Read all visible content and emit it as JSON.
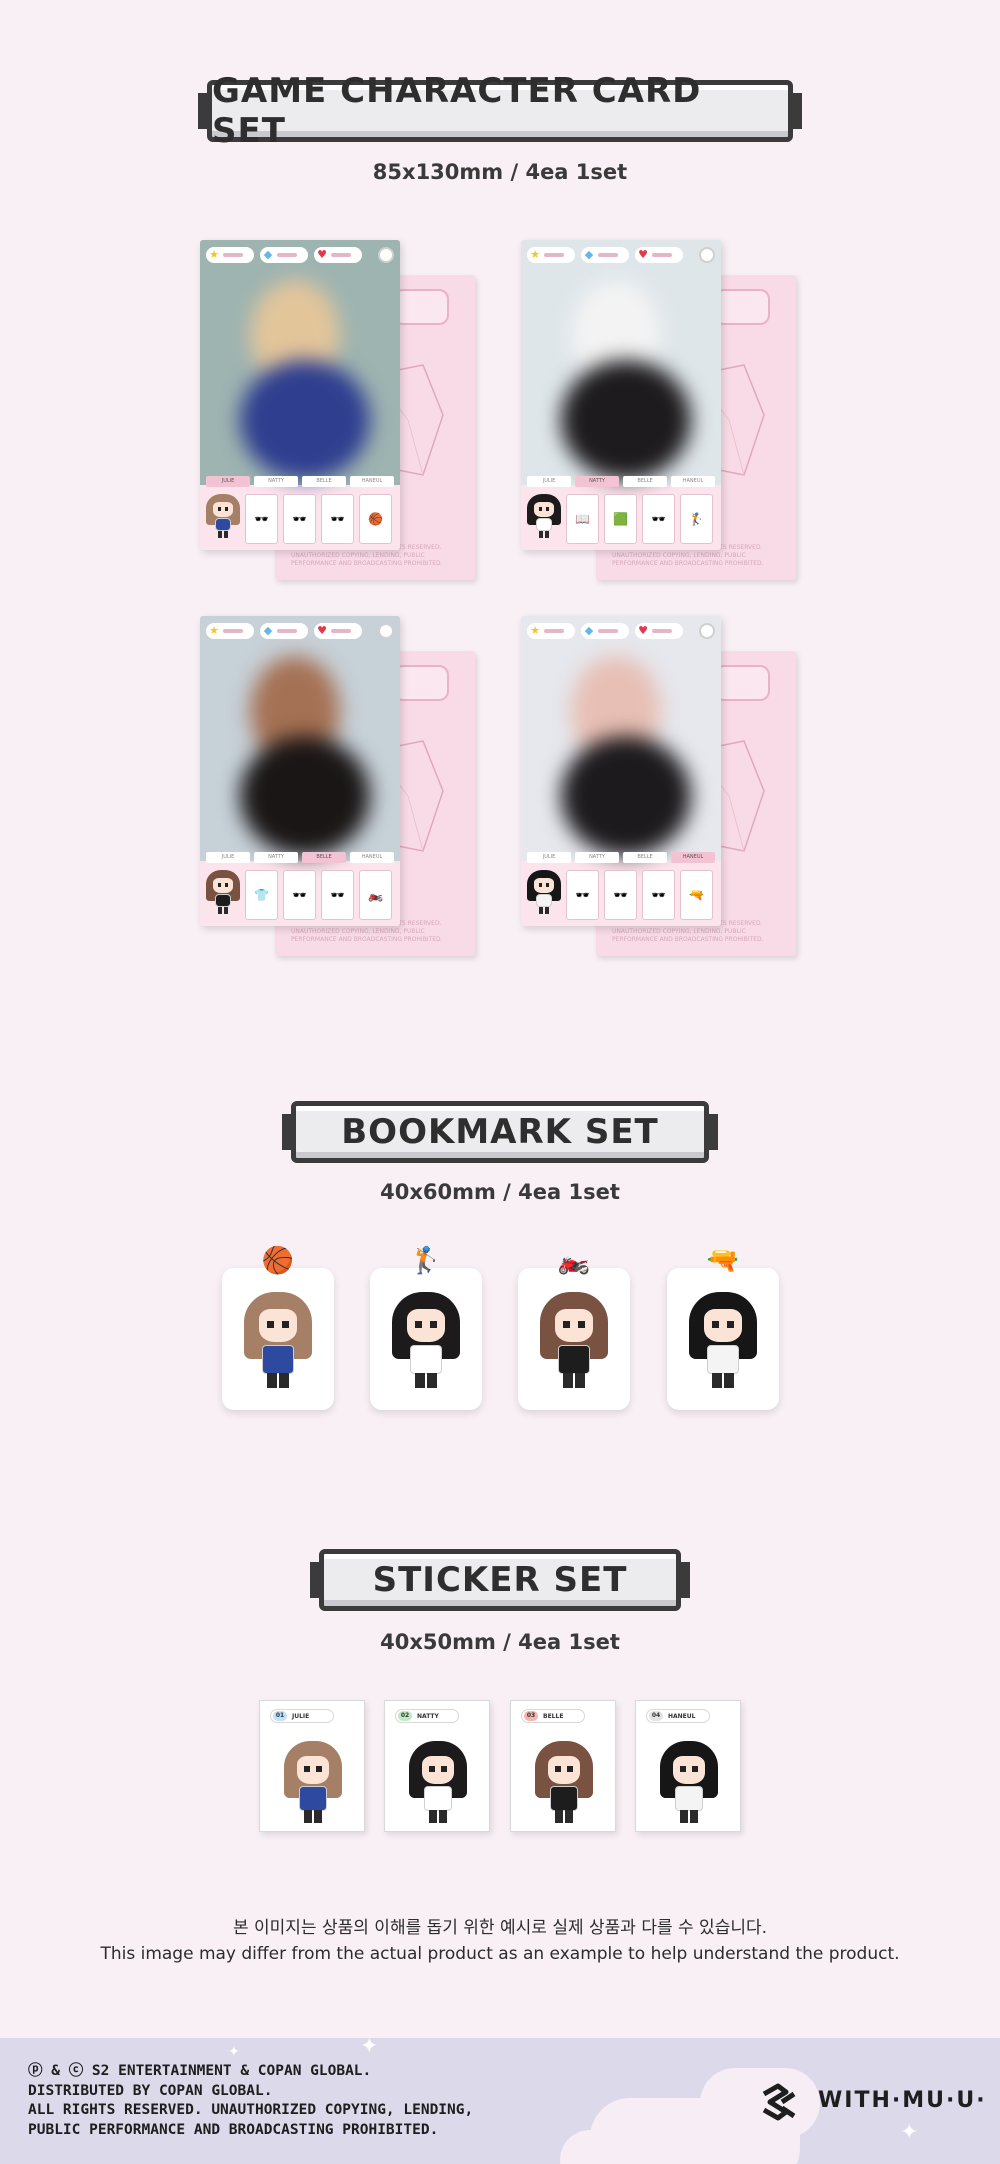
{
  "sections": {
    "cards": {
      "title": "GAME CHARACTER CARD SET",
      "spec": "85x130mm  /  4ea 1set"
    },
    "bookmarks": {
      "title": "BOOKMARK SET",
      "spec": "40x60mm  /  4ea 1set"
    },
    "stickers": {
      "title": "STICKER SET",
      "spec": "40x50mm  /  4ea 1set"
    }
  },
  "cards": [
    {
      "member": "JULIE",
      "active_tab": 0,
      "item_icons": [
        "🕶️",
        "🕶️",
        "🕶️",
        "🏀"
      ],
      "photo_colors": [
        "#9eb4b1",
        "#2f3e8f",
        "#e3c59a"
      ]
    },
    {
      "member": "NATTY",
      "active_tab": 1,
      "item_icons": [
        "📖",
        "🟩",
        "🕶️",
        "🏌️"
      ],
      "photo_colors": [
        "#dfe6ea",
        "#1d1b1e",
        "#f3f3f3"
      ]
    },
    {
      "member": "BELLE",
      "active_tab": 2,
      "item_icons": [
        "👕",
        "🕶️",
        "🕶️",
        "🏍️"
      ],
      "photo_colors": [
        "#c7d1d8",
        "#1a1616",
        "#a57154"
      ]
    },
    {
      "member": "HANEUL",
      "active_tab": 3,
      "item_icons": [
        "🕶️",
        "🕶️",
        "🕶️",
        "🔫"
      ],
      "photo_colors": [
        "#e6e8ee",
        "#1c1a1d",
        "#e7bfb4"
      ]
    }
  ],
  "card_tabs": [
    "JULIE",
    "NATTY",
    "BELLE",
    "HANEUL"
  ],
  "hud_icons": {
    "star": "★",
    "gem": "◆",
    "heart": "♥"
  },
  "card_fine_print": "ⓟ&ⓒS2 ENTERTAINMENT. ALL RIGHTS RESERVED. UNAUTHORIZED COPYING, LENDING, PUBLIC PERFORMANCE AND BROADCASTING PROHIBITED.",
  "bookmarks": [
    {
      "member": "JULIE",
      "item": "🏀",
      "hair": "#a57f66",
      "outfit": "#2e4aa0"
    },
    {
      "member": "NATTY",
      "item": "🏌️",
      "hair": "#1c1a1a",
      "outfit": "#ffffff"
    },
    {
      "member": "BELLE",
      "item": "🏍️",
      "hair": "#7a5241",
      "outfit": "#1d1d1d"
    },
    {
      "member": "HANEUL",
      "item": "🔫",
      "hair": "#161616",
      "outfit": "#f4f4f4"
    }
  ],
  "stickers": [
    {
      "num": "01",
      "name": "JULIE",
      "num_color": "#bfe0f5",
      "hair": "#a57f66",
      "outfit": "#2e4aa0"
    },
    {
      "num": "02",
      "name": "NATTY",
      "num_color": "#bfe9c4",
      "hair": "#1c1a1a",
      "outfit": "#ffffff"
    },
    {
      "num": "03",
      "name": "BELLE",
      "num_color": "#f6b4b0",
      "hair": "#7a5241",
      "outfit": "#1d1d1d"
    },
    {
      "num": "04",
      "name": "HANEUL",
      "num_color": "#e3e3e3",
      "hair": "#161616",
      "outfit": "#f4f4f4"
    }
  ],
  "notes": {
    "korean": "본 이미지는 상품의 이해를 돕기 위한 예시로 실제 상품과 다를 수 있습니다.",
    "english": "This image may differ from the actual product as an example to help understand the product."
  },
  "footer": {
    "legal": [
      "ⓟ & ⓒ S2 ENTERTAINMENT & COPAN GLOBAL.",
      "DISTRIBUTED BY COPAN GLOBAL.",
      "ALL RIGHTS RESERVED. UNAUTHORIZED COPYING, LENDING,",
      "PUBLIC PERFORMANCE AND BROADCASTING PROHIBITED."
    ],
    "logo_text": "WITH·MU·U·"
  },
  "colors": {
    "background": "#f8f0f4",
    "card_pink": "#f8dbe6",
    "footer": "#dcd9ea",
    "plaque_border": "#3b3b3b"
  }
}
